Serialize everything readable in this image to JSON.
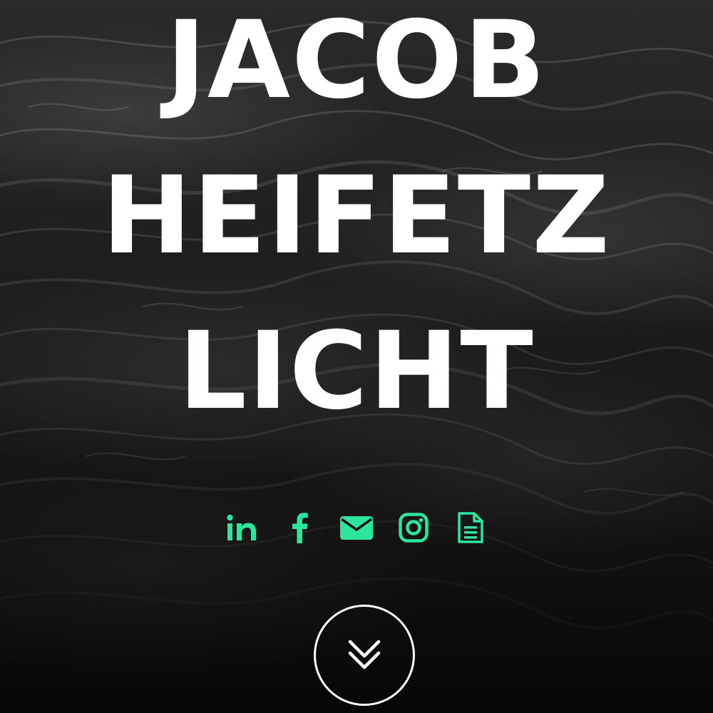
{
  "hero": {
    "name_lines": [
      "JACOB",
      "HEIFETZ",
      "LICHT"
    ]
  },
  "social": {
    "accent_color": "#2ee59d",
    "links": [
      {
        "icon": "linkedin-icon"
      },
      {
        "icon": "facebook-icon"
      },
      {
        "icon": "email-icon"
      },
      {
        "icon": "instagram-icon"
      },
      {
        "icon": "resume-document-icon"
      }
    ]
  },
  "scroll": {
    "icon": "double-chevron-down-icon",
    "border_color": "#ffffff"
  }
}
